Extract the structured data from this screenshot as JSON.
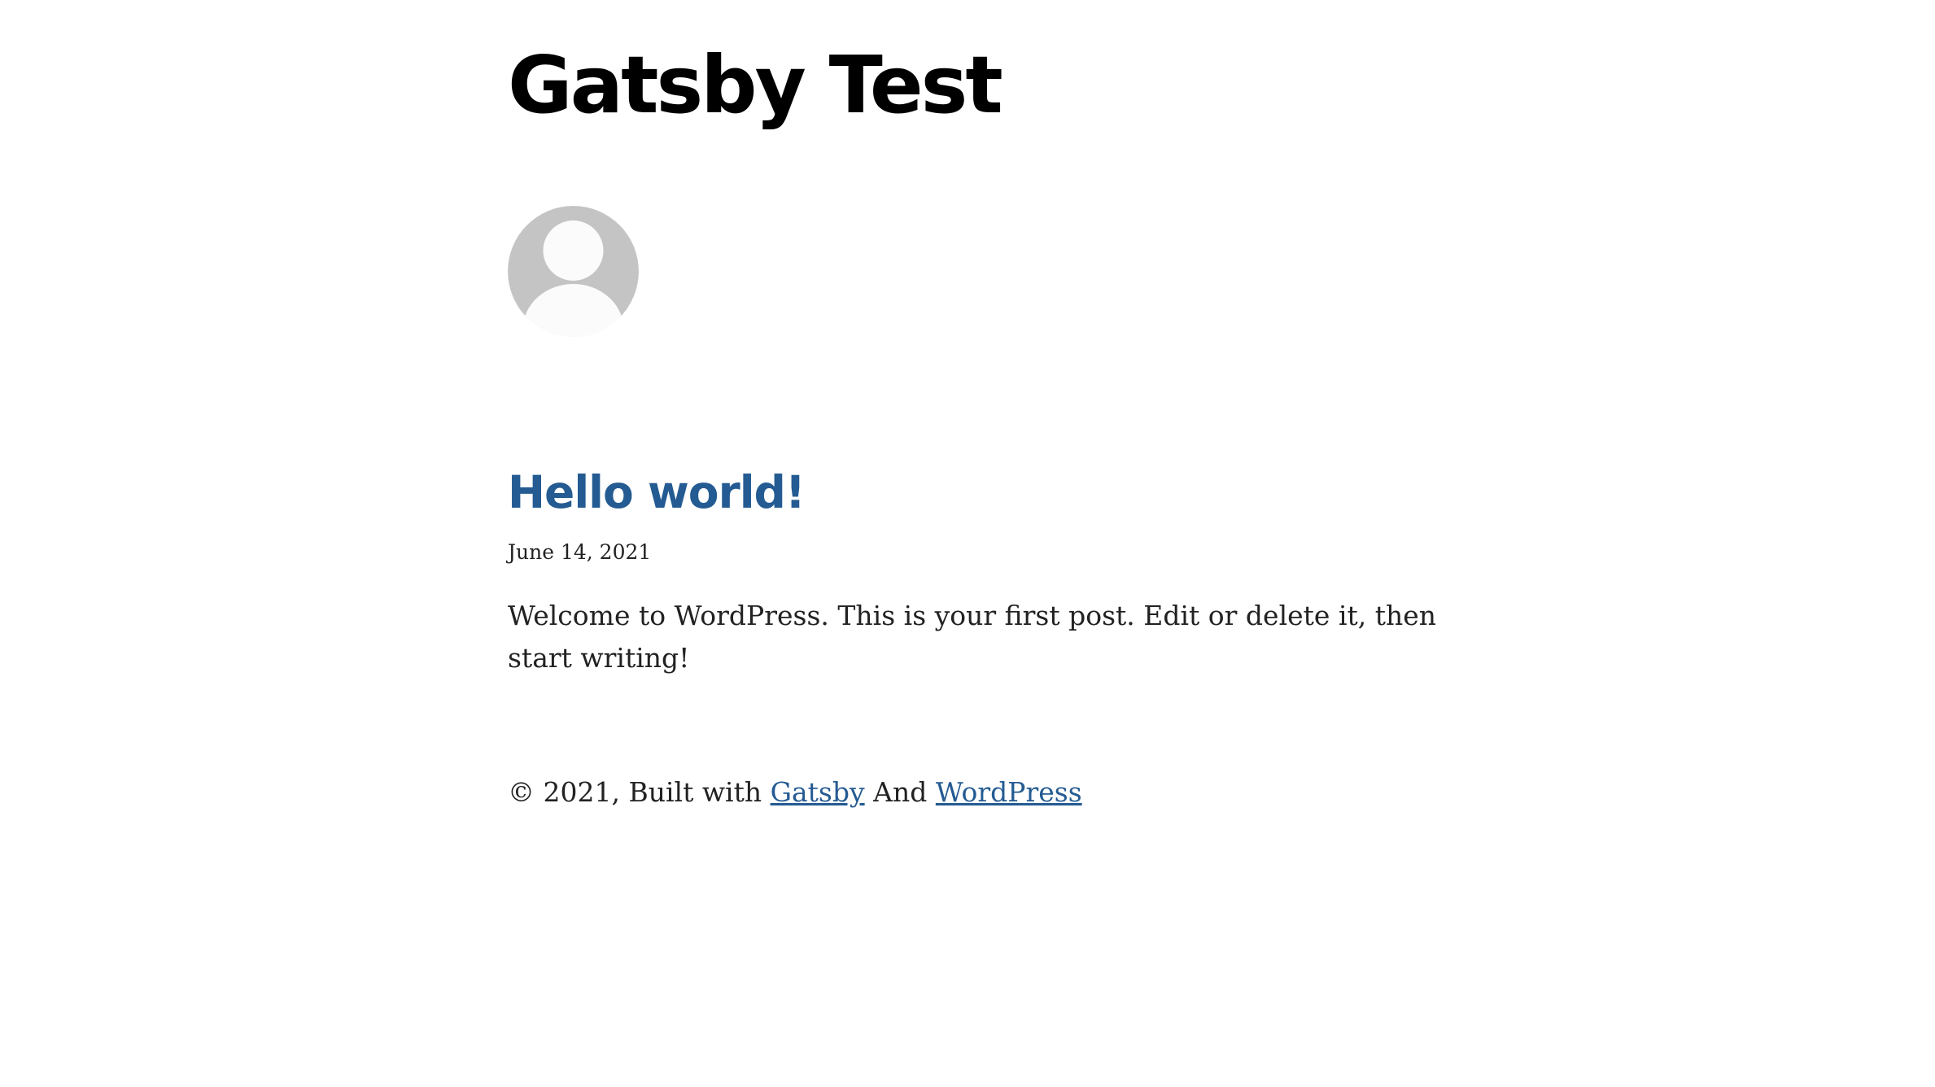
{
  "site": {
    "title": "Gatsby Test"
  },
  "avatar": {
    "icon": "default-user-avatar-icon"
  },
  "post": {
    "title": "Hello world!",
    "date": "June 14, 2021",
    "excerpt": "Welcome to WordPress. This is your first post. Edit or delete it, then start writing!"
  },
  "footer": {
    "prefix": "© 2021, Built with ",
    "gatsby_link": "Gatsby",
    "connector": " And ",
    "wordpress_link": "WordPress"
  },
  "colors": {
    "link": "#245b92",
    "text": "#222222",
    "heading": "#000000",
    "avatar_bg": "#c4c4c4"
  }
}
